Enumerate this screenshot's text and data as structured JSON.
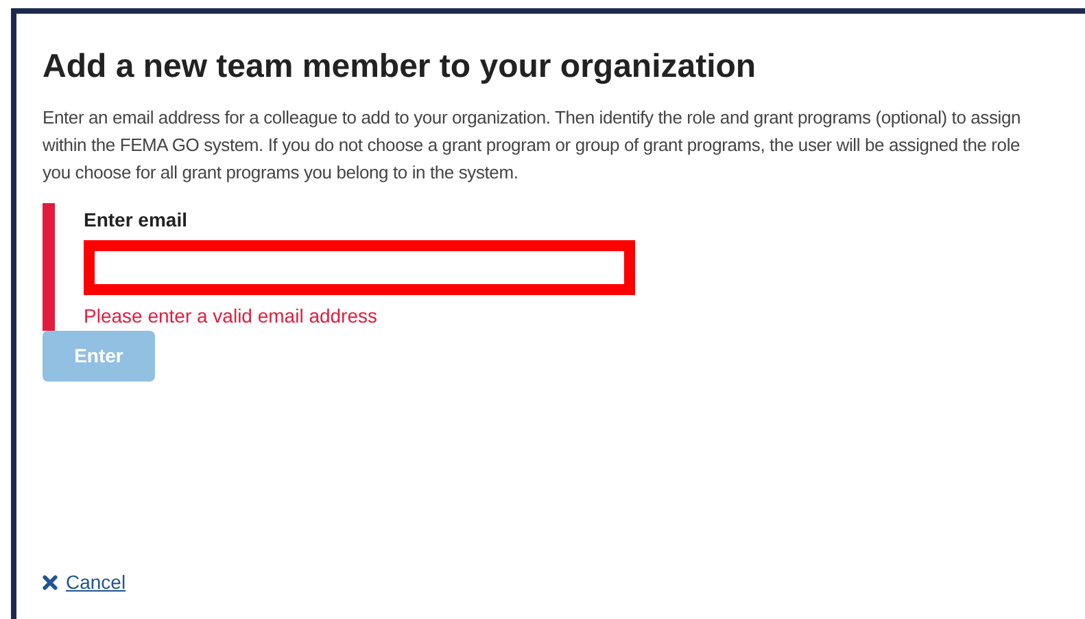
{
  "dialog": {
    "title": "Add a new team member to your organization",
    "description": "Enter an email address for a colleague to add to your organization. Then identify the role and grant programs (optional) to assign within the FEMA GO system. If you do not choose a grant program or group of grant programs, the user will be assigned the role you choose for all grant programs you belong to in the system.",
    "email_field": {
      "label": "Enter email",
      "error": true,
      "error_message": "Please enter a valid email address"
    },
    "enter_button": {
      "label": "Enter",
      "disabled": true
    },
    "cancel_link": {
      "label": "Cancel"
    }
  }
}
